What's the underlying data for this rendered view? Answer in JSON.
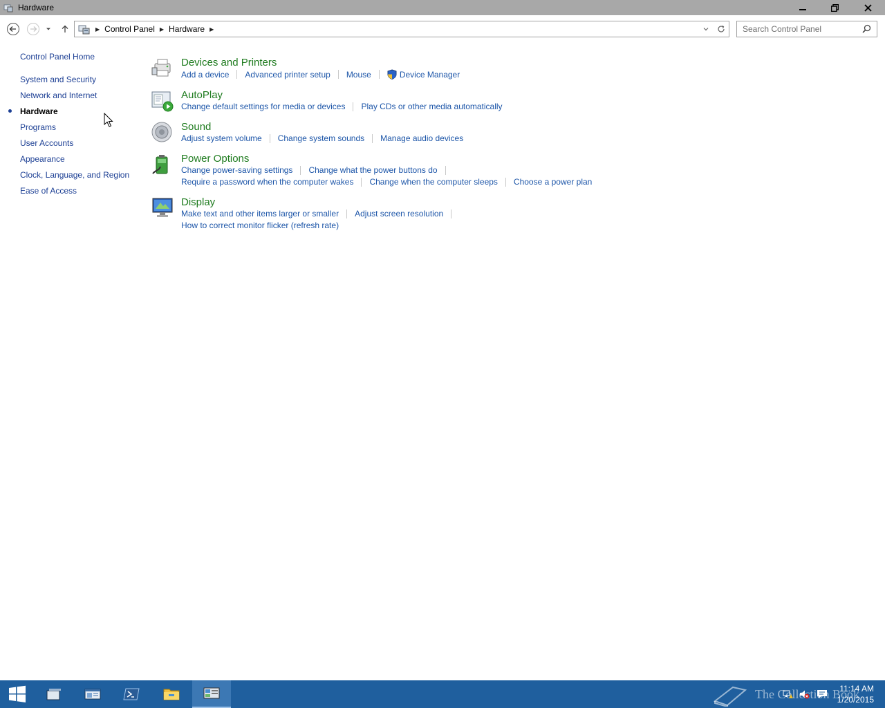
{
  "window": {
    "title": "Hardware"
  },
  "address": {
    "crumbs": [
      "Control Panel",
      "Hardware"
    ],
    "search_placeholder": "Search Control Panel"
  },
  "leftnav": {
    "home": "Control Panel Home",
    "items": [
      "System and Security",
      "Network and Internet",
      "Hardware",
      "Programs",
      "User Accounts",
      "Appearance",
      "Clock, Language, and Region",
      "Ease of Access"
    ],
    "current": "Hardware"
  },
  "categories": [
    {
      "title": "Devices and Printers",
      "icon": "printer-icon",
      "links": [
        [
          "Add a device",
          "Advanced printer setup",
          "Mouse",
          "Device Manager"
        ]
      ]
    },
    {
      "title": "AutoPlay",
      "icon": "autoplay-icon",
      "links": [
        [
          "Change default settings for media or devices",
          "Play CDs or other media automatically"
        ]
      ]
    },
    {
      "title": "Sound",
      "icon": "speaker-icon",
      "links": [
        [
          "Adjust system volume",
          "Change system sounds",
          "Manage audio devices"
        ]
      ]
    },
    {
      "title": "Power Options",
      "icon": "battery-icon",
      "links": [
        [
          "Change power-saving settings",
          "Change what the power buttons do"
        ],
        [
          "Require a password when the computer wakes",
          "Change when the computer sleeps",
          "Choose a power plan"
        ]
      ]
    },
    {
      "title": "Display",
      "icon": "monitor-icon",
      "links": [
        [
          "Make text and other items larger or smaller",
          "Adjust screen resolution"
        ],
        [
          "How to correct monitor flicker (refresh rate)"
        ]
      ]
    }
  ],
  "taskbar": {
    "watermark": "The Collection Book",
    "time": "11:14 AM",
    "date": "1/20/2015"
  },
  "colors": {
    "title_bar": "#a8a8a8",
    "taskbar": "#1f5f9e",
    "link": "#1c55a8",
    "category_title": "#1e7b1e"
  }
}
